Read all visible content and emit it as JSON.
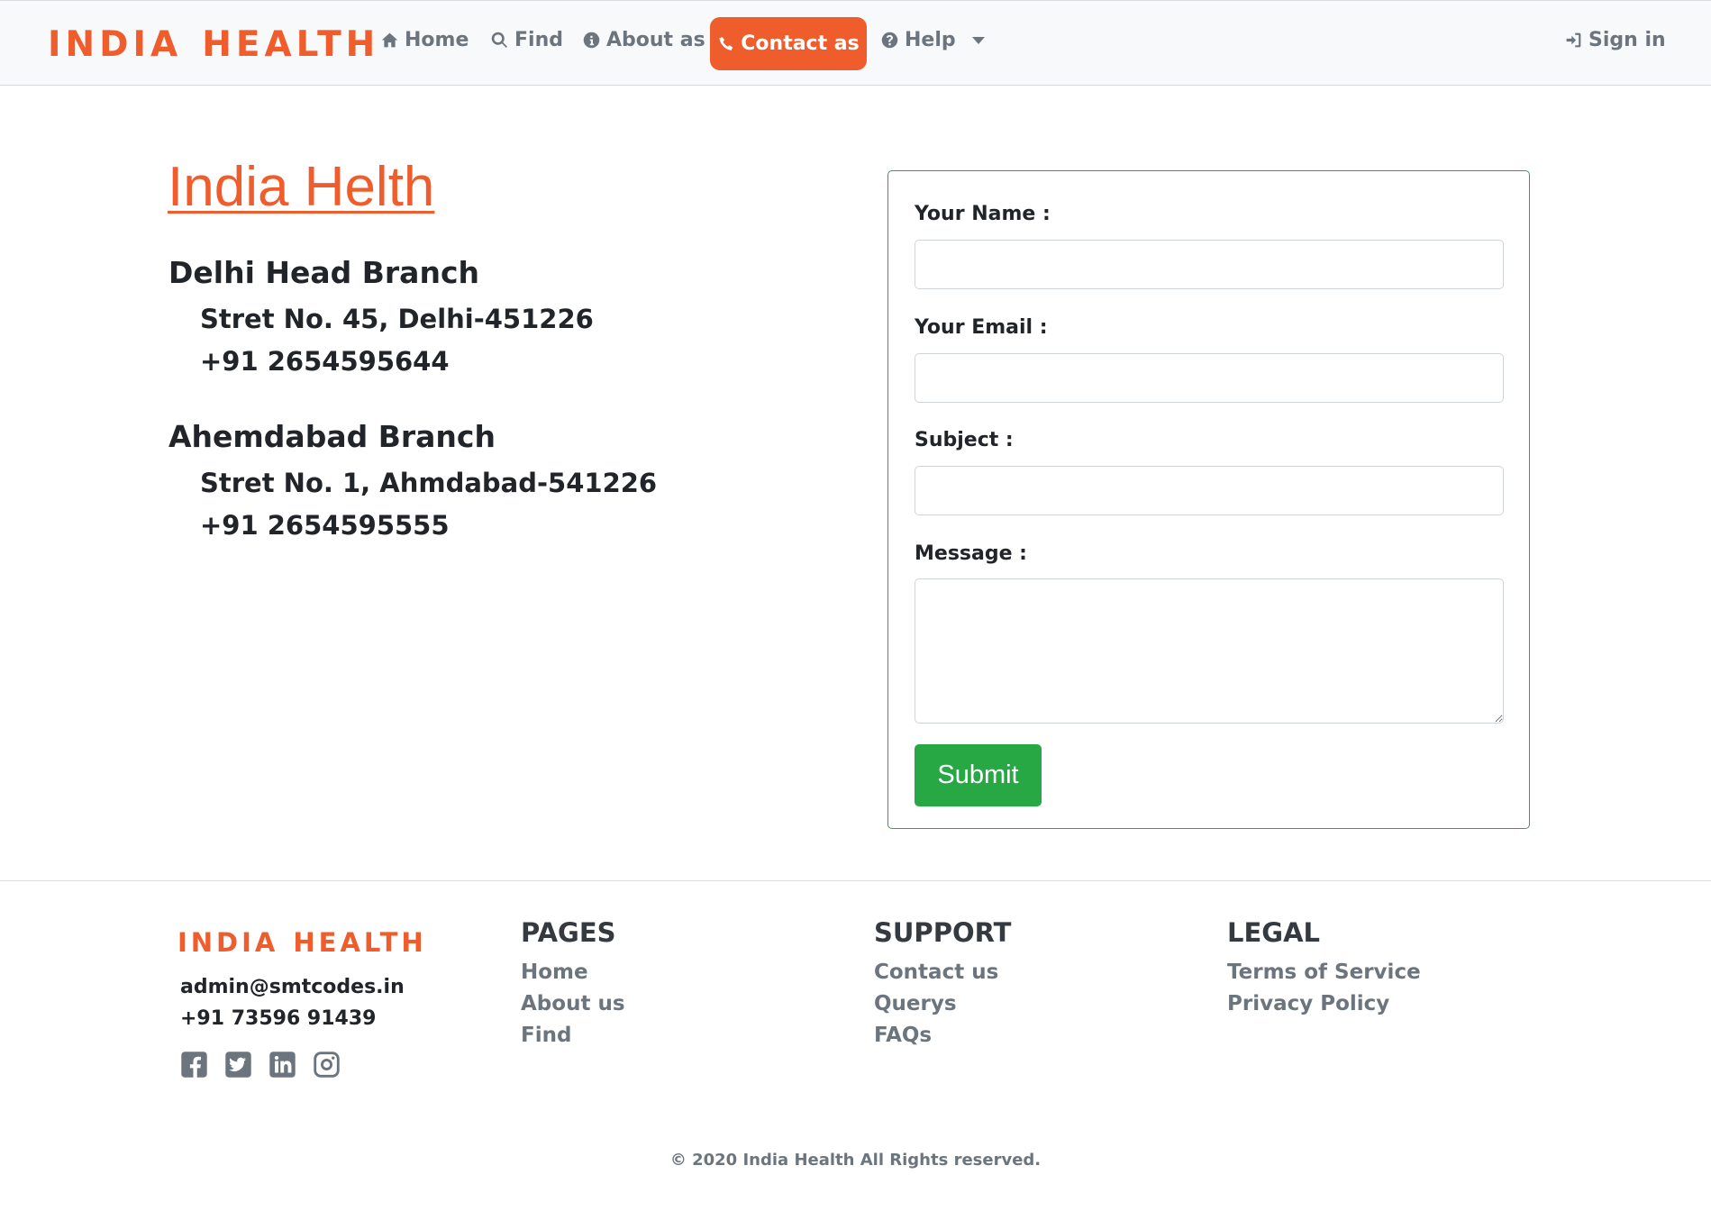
{
  "navbar": {
    "brand_word1": "INDIA",
    "brand_word2": "HEALTH",
    "home": "Home",
    "find": "Find",
    "about": "About as",
    "contact": "Contact as",
    "help": "Help",
    "signin": "Sign in",
    "icons": {
      "home": "home-icon",
      "find": "search-icon",
      "about": "info-icon",
      "contact": "phone-icon",
      "help": "question-icon",
      "signin": "sign-in-icon"
    }
  },
  "info": {
    "title": "India Helth",
    "branches": [
      {
        "name": "Delhi Head Branch",
        "address": "Stret No. 45, Delhi-451226",
        "phone": "+91 2654595644"
      },
      {
        "name": "Ahemdabad Branch",
        "address": "Stret No. 1, Ahmdabad-541226",
        "phone": "+91 2654595555"
      }
    ]
  },
  "form": {
    "name_label": "Your Name :",
    "email_label": "Your Email :",
    "subject_label": "Subject :",
    "message_label": "Message :",
    "name_value": "",
    "email_value": "",
    "subject_value": "",
    "message_value": "",
    "submit_label": "Submit"
  },
  "footer": {
    "brand_word1": "INDIA",
    "brand_word2": "HEALTH",
    "email": "admin@smtcodes.in",
    "phone": "+91 73596 91439",
    "socials": [
      "facebook-icon",
      "twitter-icon",
      "linkedin-icon",
      "instagram-icon"
    ],
    "columns": [
      {
        "heading": "PAGES",
        "links": [
          "Home",
          "About us",
          "Find"
        ]
      },
      {
        "heading": "SUPPORT",
        "links": [
          "Contact us",
          "Querys",
          "FAQs"
        ]
      },
      {
        "heading": "LEGAL",
        "links": [
          "Terms of Service",
          "Privacy Policy"
        ]
      }
    ],
    "copyright": "© 2020 India Health All Rights reserved."
  },
  "colors": {
    "brand": "#f05d2c",
    "success": "#28a745",
    "muted": "#6c757d",
    "navbar_bg": "#f8f9fa"
  }
}
